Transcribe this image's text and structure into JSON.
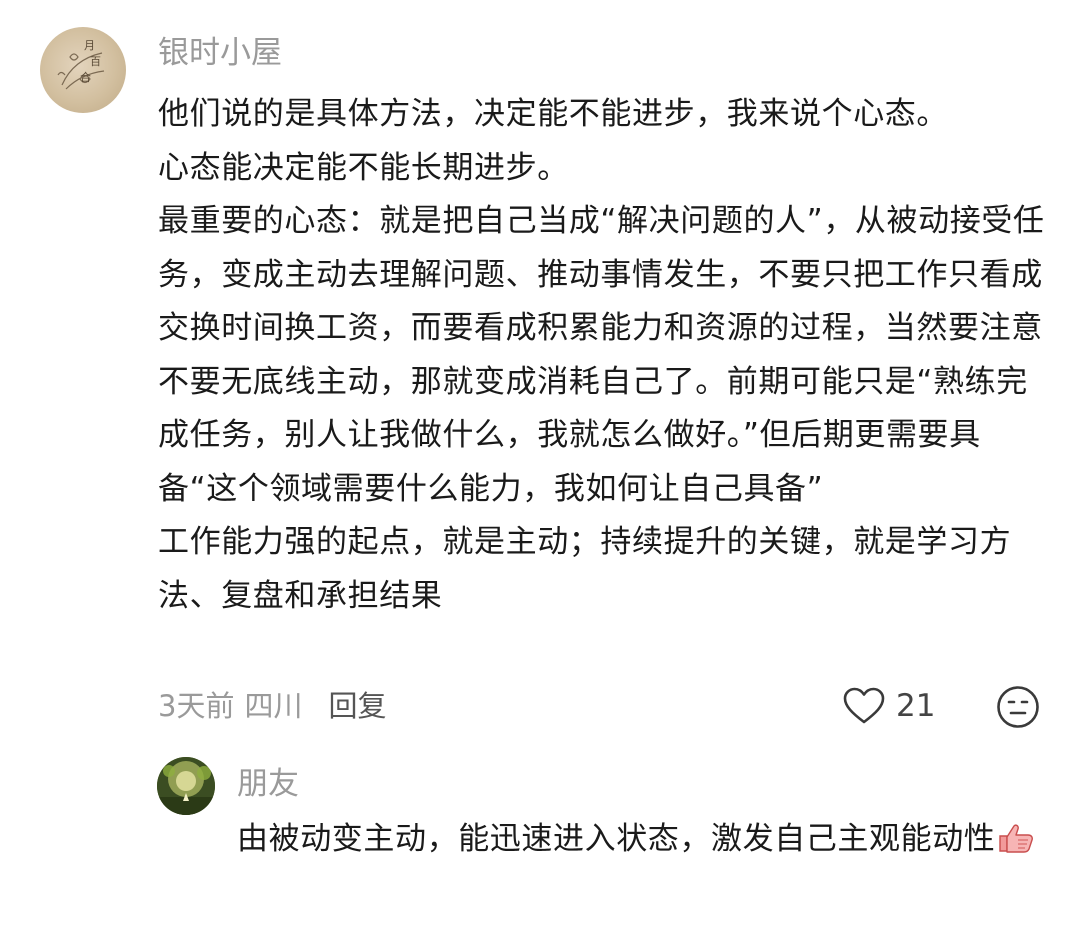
{
  "comment": {
    "username": "银时小屋",
    "avatar_icon": "avatar-icon",
    "paragraphs": [
      "他们说的是具体方法，决定能不能进步，我来说个心态。",
      "心态能决定能不能长期进步。",
      "最重要的心态：就是把自己当成“解决问题的人”，从被动接受任务，变成主动去理解问题、推动事情发生，不要只把工作只看成交换时间换工资，而要看成积累能力和资源的过程，当然要注意不要无底线主动，那就变成消耗自己了。前期可能只是“熟练完成任务，别人让我做什么，我就怎么做好。”但后期更需要具备“这个领域需要什么能力，我如何让自己具备”",
      "工作能力强的起点，就是主动；持续提升的关键，就是学习方法、复盘和承担结果"
    ],
    "time": "3天前",
    "location": "四川",
    "reply_label": "回复",
    "like_count": "21",
    "like_icon": "heart-outline-icon",
    "emoji_icon": "emoji-face-icon"
  },
  "reply": {
    "username": "朋友",
    "text": "由被动变主动，能迅速进入状态，激发自己主观能动性",
    "trailing_emoji": "thumbs-up-icon"
  },
  "colors": {
    "username": "#9a9a9a",
    "text": "#1a1a1a",
    "meta": "#9a9a9a",
    "reply_button": "#555555",
    "icon_stroke": "#3a3a3a"
  }
}
